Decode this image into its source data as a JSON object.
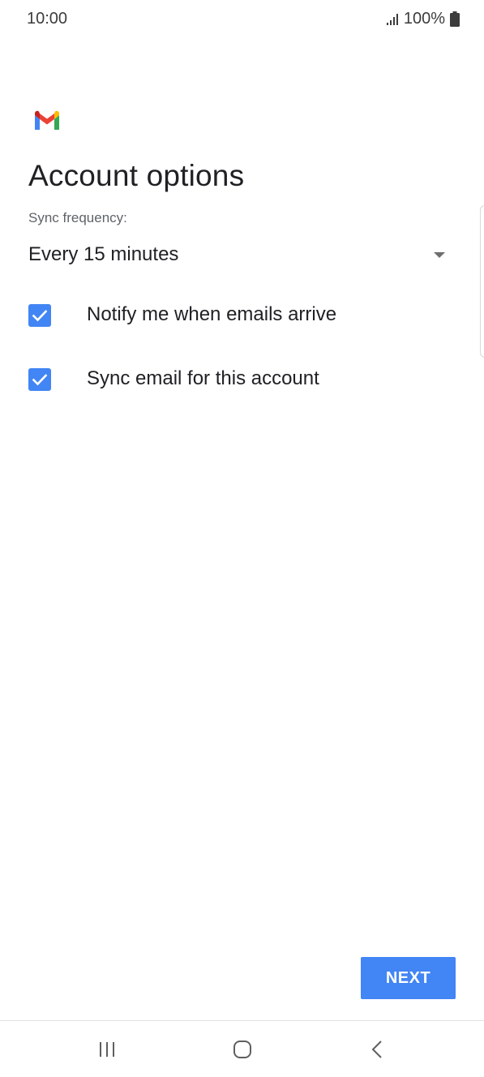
{
  "status_bar": {
    "time": "10:00",
    "battery_percent": "100%",
    "icons": [
      "signal-icon",
      "battery-icon"
    ]
  },
  "app": {
    "logo": "gmail-logo",
    "title": "Account options"
  },
  "sync": {
    "label": "Sync frequency:",
    "selected": "Every 15 minutes"
  },
  "options": [
    {
      "label": "Notify me when emails arrive",
      "checked": true
    },
    {
      "label": "Sync email for this account",
      "checked": true
    }
  ],
  "actions": {
    "next_label": "NEXT"
  },
  "nav_bar": {
    "buttons": [
      "recents-icon",
      "home-icon",
      "back-icon"
    ]
  },
  "colors": {
    "accent": "#4285f4",
    "text_primary": "#202124",
    "text_secondary": "#5f6368"
  }
}
